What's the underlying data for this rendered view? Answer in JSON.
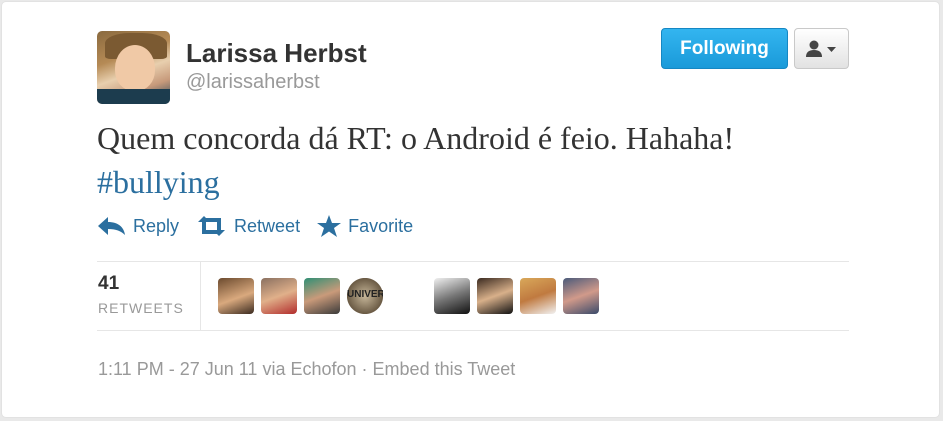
{
  "user": {
    "name": "Larissa Herbst",
    "handle": "@larissaherbst"
  },
  "buttons": {
    "follow_label": "Following",
    "user_menu_icon": "user-dropdown-icon"
  },
  "tweet": {
    "text": "Quem concorda dá RT: o Android é feio. Hahaha!",
    "hashtag": "#bullying"
  },
  "actions": {
    "reply": "Reply",
    "retweet": "Retweet",
    "favorite": "Favorite"
  },
  "stats": {
    "retweets_count": "41",
    "retweets_label": "RETWEETS"
  },
  "footer": {
    "time": "1:11 PM - 27 Jun 11",
    "via": "via Echofon",
    "separator": "·",
    "embed": "Embed this Tweet"
  },
  "colors": {
    "link": "#2b6f9f",
    "follow_button": "#1a9ad9",
    "muted": "#999999"
  }
}
